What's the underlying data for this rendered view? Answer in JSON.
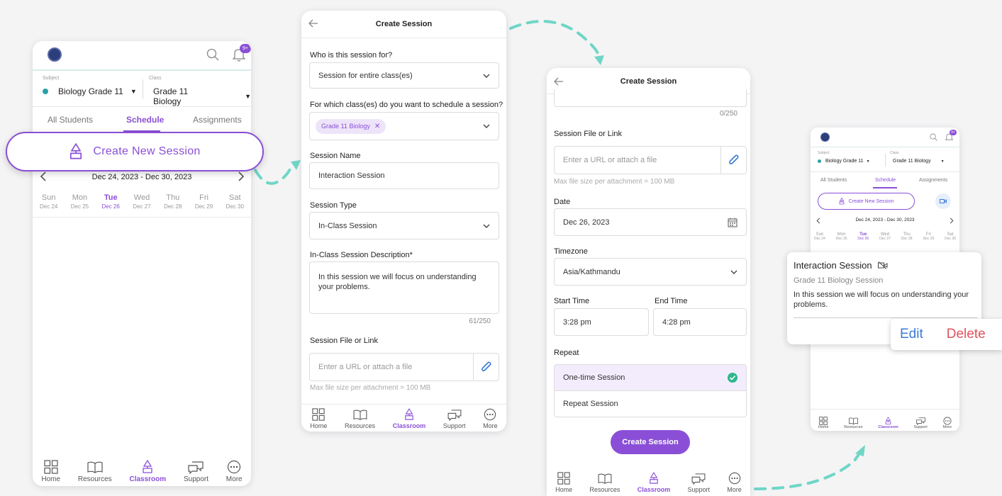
{
  "phone1": {
    "subject_label": "Subject",
    "subject_value": "Biology Grade 11",
    "class_label": "Class",
    "class_value": "Grade 11 Biology",
    "badge": "9+",
    "tabs": [
      "All Students",
      "Schedule",
      "Assignments"
    ],
    "create_button": "Create New Session",
    "week_range": "Dec 24, 2023 - Dec 30, 2023",
    "days": [
      {
        "name": "Sun",
        "date": "Dec 24"
      },
      {
        "name": "Mon",
        "date": "Dec 25"
      },
      {
        "name": "Tue",
        "date": "Dec 26"
      },
      {
        "name": "Wed",
        "date": "Dec 27"
      },
      {
        "name": "Thu",
        "date": "Dec 28"
      },
      {
        "name": "Fri",
        "date": "Dec 29"
      },
      {
        "name": "Sat",
        "date": "Dec 30"
      }
    ]
  },
  "nav": [
    "Home",
    "Resources",
    "Classroom",
    "Support",
    "More"
  ],
  "phone2": {
    "title": "Create Session",
    "q1_label": "Who is this session for?",
    "q1_value": "Session for entire class(es)",
    "q2_label": "For which class(es) do you want to schedule a session?",
    "q2_chip": "Grade 11 Biology",
    "name_label": "Session Name",
    "name_value": "Interaction Session",
    "type_label": "Session Type",
    "type_value": "In-Class Session",
    "desc_label": "In-Class Session Description*",
    "desc_value": "In this session we will focus on understanding your problems.",
    "desc_count": "61/250",
    "file_label": "Session File or Link",
    "file_placeholder": "Enter a URL or attach a file",
    "file_hint": "Max file size per attachment = 100 MB"
  },
  "phone3": {
    "title": "Create Session",
    "count": "0/250",
    "file_label": "Session File or Link",
    "file_placeholder": "Enter a URL or attach a file",
    "file_hint": "Max file size per attachment = 100 MB",
    "date_label": "Date",
    "date_value": "Dec 26, 2023",
    "tz_label": "Timezone",
    "tz_value": "Asia/Kathmandu",
    "start_label": "Start Time",
    "start_value": "3:28 pm",
    "end_label": "End Time",
    "end_value": "4:28 pm",
    "repeat_label": "Repeat",
    "repeat_opt1": "One-time Session",
    "repeat_opt2": "Repeat Session",
    "submit": "Create Session"
  },
  "phone4": {
    "badge": "9+",
    "subject_label": "Subject",
    "subject_value": "Biology Grade 11",
    "class_label": "Class",
    "class_value": "Grade 11 Biology",
    "tabs": [
      "All Students",
      "Schedule",
      "Assignments"
    ],
    "create_button": "Create New Session",
    "week_range": "Dec 24, 2023 - Dec 30, 2023",
    "days": [
      {
        "name": "Sun",
        "date": "Dec 24"
      },
      {
        "name": "Mon",
        "date": "Dec 25"
      },
      {
        "name": "Tue",
        "date": "Dec 26"
      },
      {
        "name": "Wed",
        "date": "Dec 27"
      },
      {
        "name": "Thu",
        "date": "Dec 28"
      },
      {
        "name": "Fri",
        "date": "Dec 29"
      },
      {
        "name": "Sat",
        "date": "Dec 30"
      }
    ]
  },
  "card": {
    "title": "Interaction Session",
    "subtitle": "Grade 11 Biology Session",
    "desc": "In this session we will focus on understanding your problems.",
    "edit": "Edit",
    "delete": "Delete"
  },
  "colors": {
    "accent": "#8a4fd6",
    "dash": "#6fd6c6",
    "edit": "#3a7bd5",
    "delete": "#e0525e",
    "check": "#2eb88a"
  }
}
